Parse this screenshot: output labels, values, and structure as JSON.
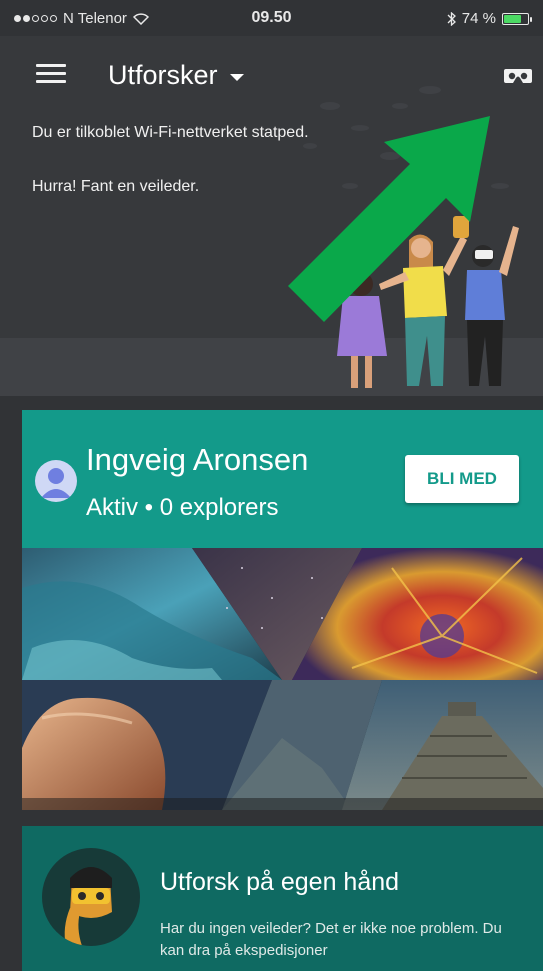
{
  "statusbar": {
    "carrier": "N Telenor",
    "time": "09.50",
    "battery": "74 %",
    "battery_level": 0.74
  },
  "header": {
    "title": "Utforsker",
    "wifi_message": "Du er tilkoblet Wi-Fi-nettverket statped.",
    "found_message": "Hurra! Fant en veileder."
  },
  "guide": {
    "name": "Ingveig Aronsen",
    "status": "Aktiv • 0 explorers",
    "join_label": "BLI MED"
  },
  "explore": {
    "title": "Utforsk på egen hånd",
    "text": "Har du ingen veileder? Det er ikke noe problem. Du kan dra på ekspedisjoner"
  },
  "colors": {
    "teal": "#139a8a",
    "dark_teal": "#0f6a62",
    "arrow_green": "#0aa84a",
    "background": "#313336"
  },
  "icons": [
    "menu-icon",
    "dropdown-caret-icon",
    "vr-headset-icon",
    "wifi-icon",
    "bluetooth-icon",
    "battery-icon",
    "avatar-icon"
  ]
}
